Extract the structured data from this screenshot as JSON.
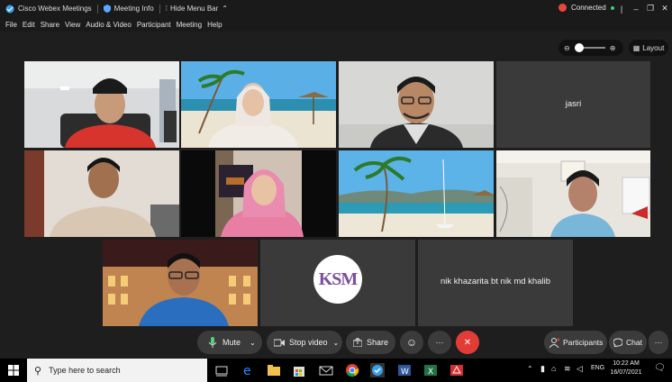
{
  "window": {
    "app_title": "Cisco Webex Meetings",
    "meeting_info": "Meeting Info",
    "hide_menu": "Hide Menu Bar",
    "status": "Connected",
    "status_color": "#e8473e"
  },
  "menu": [
    "File",
    "Edit",
    "Share",
    "View",
    "Audio & Video",
    "Participant",
    "Meeting",
    "Help"
  ],
  "view": {
    "layout_label": "Layout"
  },
  "participants": {
    "jasri": "jasri",
    "nik": "nik khazarita bt nik md khalib",
    "logo_text": "KSM"
  },
  "controls": {
    "mute": "Mute",
    "stop_video": "Stop video",
    "share": "Share",
    "participants": "Participants",
    "chat": "Chat",
    "more": "···"
  },
  "taskbar": {
    "search_placeholder": "Type here to search",
    "lang": "ENG",
    "time": "10:22 AM",
    "date": "16/07/2021"
  }
}
